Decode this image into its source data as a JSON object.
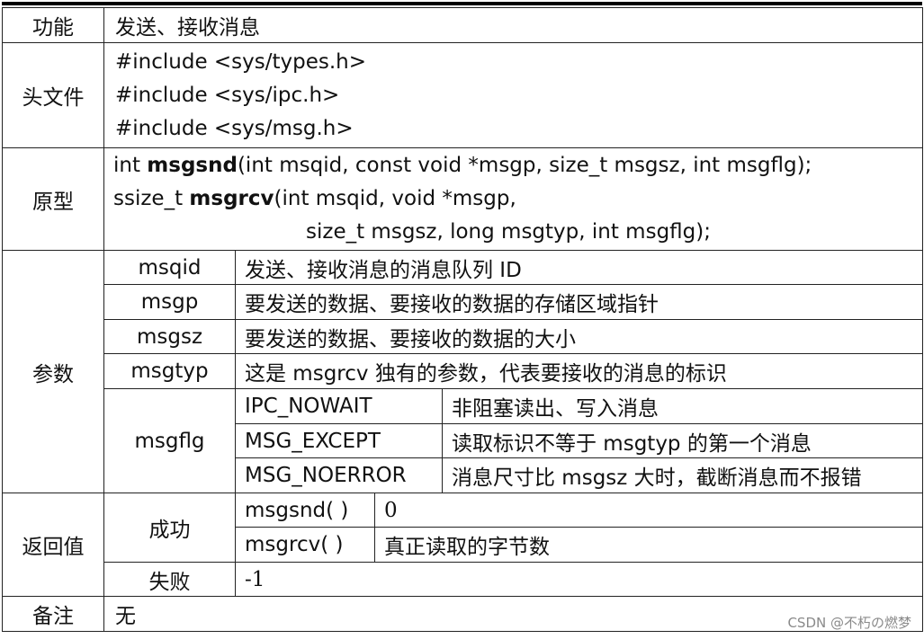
{
  "row_func": {
    "label": "功能",
    "value": "发送、接收消息"
  },
  "row_header": {
    "label": "头文件",
    "lines": [
      "#include <sys/types.h>",
      "#include <sys/ipc.h>",
      "#include <sys/msg.h>"
    ]
  },
  "row_proto": {
    "label": "原型",
    "line1_pre": "int ",
    "line1_fn": "msgsnd",
    "line1_post": "(int msqid, const void *msgp,   size_t msgsz, int msgflg);",
    "line2_pre": "ssize_t ",
    "line2_fn": "msgrcv",
    "line2_post": "(int msqid, void *msgp,",
    "line3": "size_t msgsz, long msgtyp, int msgflg);"
  },
  "row_params": {
    "label": "参数",
    "items": [
      {
        "name": "msqid",
        "desc": "发送、接收消息的消息队列 ID"
      },
      {
        "name": "msgp",
        "desc": "要发送的数据、要接收的数据的存储区域指针"
      },
      {
        "name": "msgsz",
        "desc": "要发送的数据、要接收的数据的大小"
      },
      {
        "name": "msgtyp",
        "desc": "这是 msgrcv 独有的参数，代表要接收的消息的标识"
      }
    ],
    "msgflg": {
      "name": "msgflg",
      "options": [
        {
          "flag": "IPC_NOWAIT",
          "desc": "非阻塞读出、写入消息"
        },
        {
          "flag": "MSG_EXCEPT",
          "desc": "读取标识不等于 msgtyp 的第一个消息"
        },
        {
          "flag": "MSG_NOERROR",
          "desc": "消息尺寸比 msgsz 大时，截断消息而不报错"
        }
      ]
    }
  },
  "row_return": {
    "label": "返回值",
    "success_label": "成功",
    "success_items": [
      {
        "fn": "msgsnd( )",
        "value": "0"
      },
      {
        "fn": "msgrcv( )",
        "value": "真正读取的字节数"
      }
    ],
    "fail_label": "失败",
    "fail_value": "-1"
  },
  "row_note": {
    "label": "备注",
    "value": "无"
  },
  "watermark": "CSDN @不朽の燃梦"
}
